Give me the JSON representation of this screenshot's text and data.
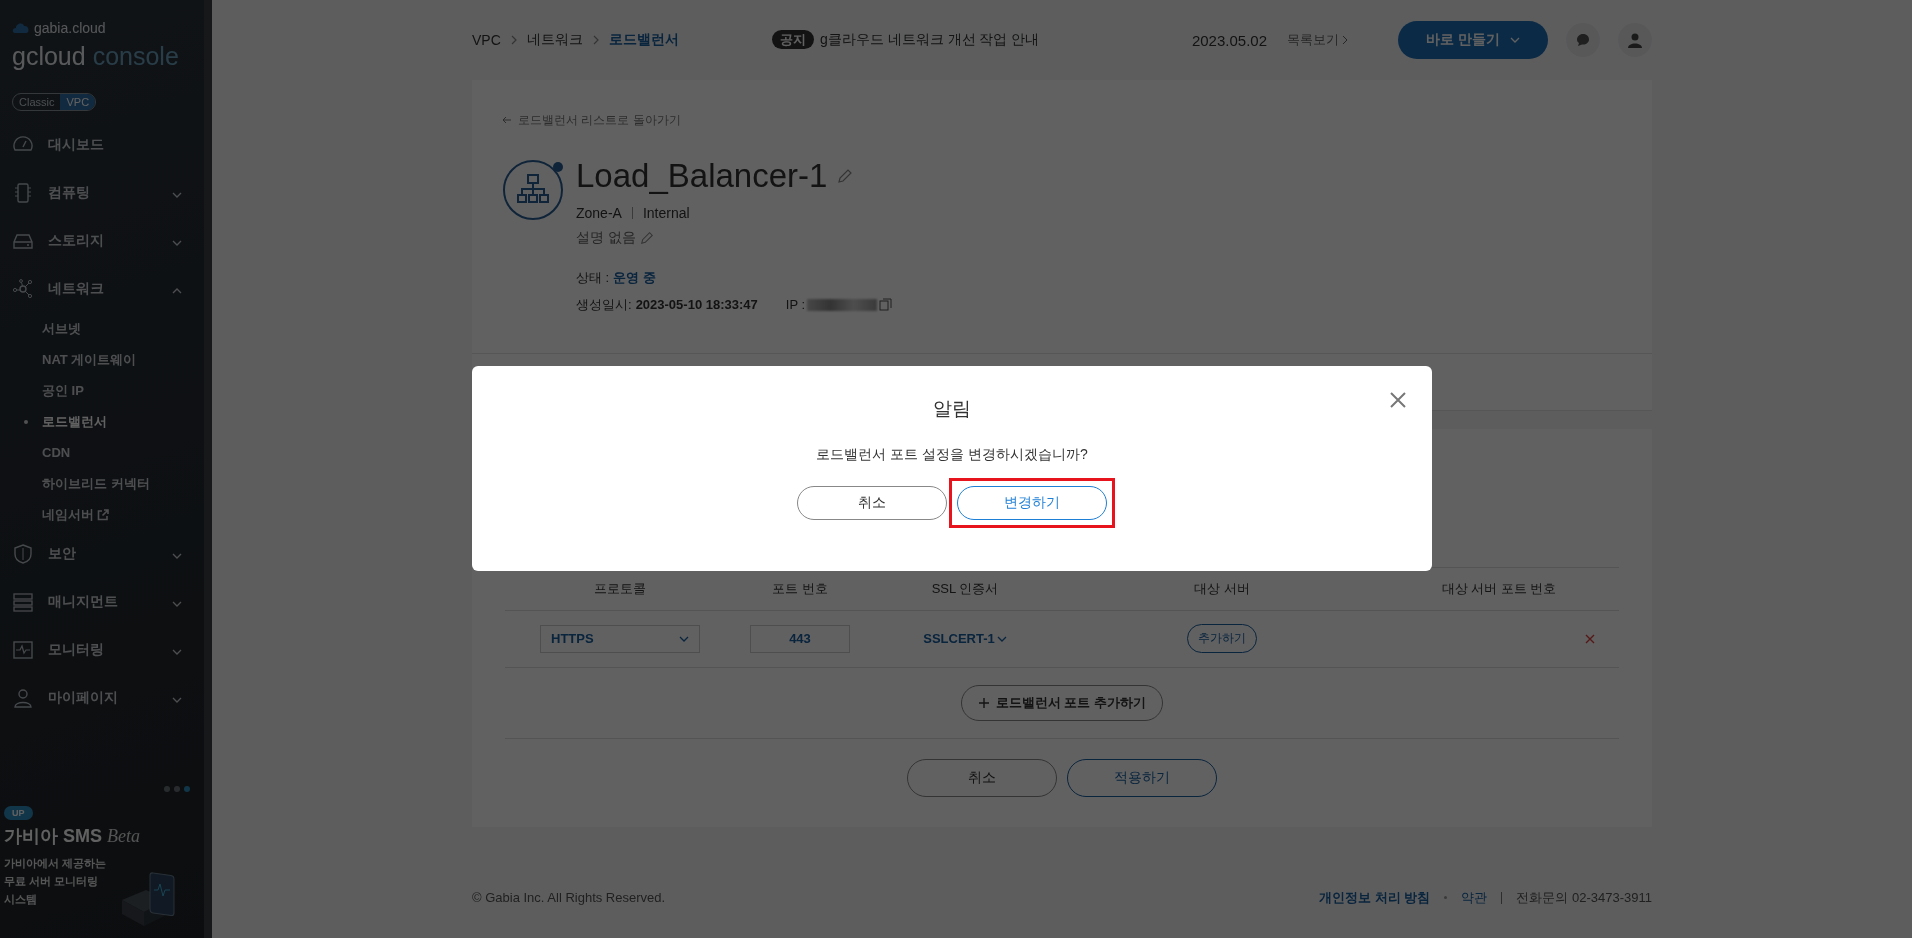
{
  "sidebar": {
    "brand": "gabia.cloud",
    "title": "gcloud",
    "subtitle": "console",
    "mode_toggle": [
      {
        "label": "Classic",
        "selected": false
      },
      {
        "label": "VPC",
        "selected": true
      }
    ],
    "menu": [
      {
        "label": "대시보드"
      },
      {
        "label": "컴퓨팅",
        "expanded": false
      },
      {
        "label": "스토리지",
        "expanded": false
      },
      {
        "label": "네트워크",
        "expanded": true,
        "children": [
          {
            "label": "서브넷",
            "selected": false
          },
          {
            "label": "NAT 게이트웨이",
            "selected": false
          },
          {
            "label": "공인 IP",
            "selected": false
          },
          {
            "label": "로드밸런서",
            "selected": true
          },
          {
            "label": "CDN",
            "selected": false
          },
          {
            "label": "하이브리드 커넥터",
            "selected": false
          },
          {
            "label": "네임서버",
            "selected": false,
            "external": true
          }
        ]
      },
      {
        "label": "보안",
        "expanded": false
      },
      {
        "label": "매니지먼트",
        "expanded": false
      },
      {
        "label": "모니터링",
        "expanded": false
      },
      {
        "label": "마이페이지",
        "expanded": false
      }
    ],
    "banner": {
      "dots": [
        {
          "selected": false
        },
        {
          "selected": false
        },
        {
          "selected": true
        }
      ],
      "badge": "UP",
      "title": "가비아 SMS",
      "title_suffix": "Beta",
      "description": "가비아에서 제공하는\n무료 서버 모니터링\n시스템"
    }
  },
  "topbar": {
    "breadcrumb": [
      "VPC",
      "네트워크",
      "로드밸런서"
    ],
    "notice_tag": "공지",
    "notice": "g클라우드 네트워크 개선 작업 안내",
    "notice_date": "2023.05.02",
    "list_link": "목록보기",
    "create_button": "바로 만들기"
  },
  "detail": {
    "back_link": "로드밸런서 리스트로 돌아가기",
    "name": "Load_Balancer-1",
    "zone": "Zone-A",
    "type": "Internal",
    "description": "설명 없음",
    "status_label": "상태 :",
    "status": "운영 중",
    "created_label": "생성일시:",
    "created": "2023-05-10 18:33:47",
    "ip_label": "IP :"
  },
  "ports": {
    "columns": [
      "프로토콜",
      "포트 번호",
      "SSL 인증서",
      "대상 서버",
      "대상 서버 포트 번호"
    ],
    "rows": [
      {
        "protocol": "HTTPS",
        "port": "443",
        "ssl": "SSLCERT-1",
        "target_button": "추가하기"
      }
    ],
    "add_button": "로드밸런서 포트 추가하기",
    "cancel_button": "취소",
    "apply_button": "적용하기"
  },
  "footer": {
    "copyright": "© Gabia Inc. All Rights Reserved.",
    "links": [
      "개인정보 처리 방침",
      "약관"
    ],
    "contact_label": "전화문의",
    "phone": "02-3473-3911"
  },
  "dialog": {
    "title": "알림",
    "message": "로드밸런서 포트 설정을 변경하시겠습니까?",
    "buttons": [
      {
        "label": "취소",
        "kind": "secondary",
        "highlighted": false
      },
      {
        "label": "변경하기",
        "kind": "primary",
        "highlighted": true
      }
    ]
  }
}
